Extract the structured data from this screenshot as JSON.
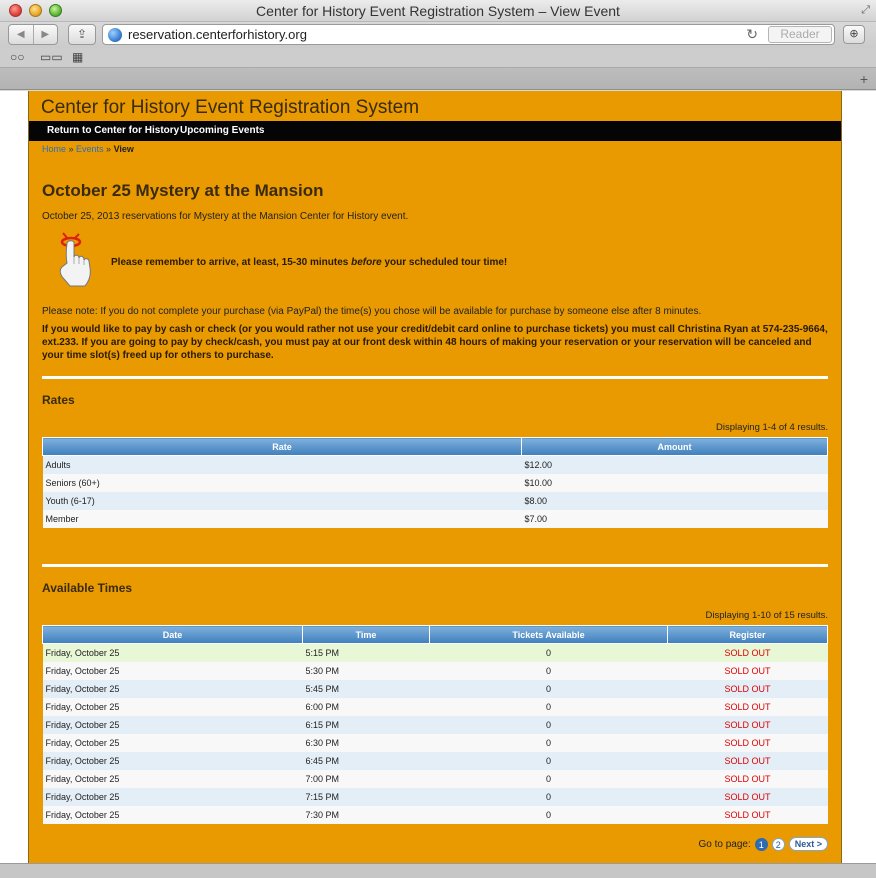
{
  "window": {
    "title": "Center for History Event Registration System – View Event",
    "url": "reservation.centerforhistory.org",
    "reader_label": "Reader",
    "nav_back": "◀",
    "nav_forward": "▶",
    "share": "⇪",
    "reload": "↻",
    "download": "⊕",
    "fullscreen": "⤢",
    "new_tab": "+",
    "bookmark_icons": [
      "○○",
      "▭▭",
      "▦"
    ]
  },
  "site": {
    "title": "Center for History Event Registration System",
    "menu": [
      "Return to Center for History",
      "Upcoming Events"
    ],
    "breadcrumb": {
      "home": "Home",
      "sep1": " » ",
      "events": "Events",
      "sep2": " » ",
      "current": "View"
    }
  },
  "event": {
    "title": "October 25 Mystery at the Mansion",
    "subtitle": "October 25, 2013 reservations for Mystery at the Mansion Center for History event.",
    "reminder_pre": "Please remember to arrive, at least, 15-30 minutes ",
    "reminder_em": "before",
    "reminder_post": " your scheduled tour time!",
    "note": "Please note: If you do not complete your purchase (via PayPal) the time(s) you chose will be available for purchase by someone else after 8 minutes.",
    "bold_note": "If you would like to pay by cash or check (or you would rather not use your credit/debit card online to purchase tickets) you must call Christina Ryan at 574-235-9664, ext.233. If you are going to pay by check/cash, you must pay at our front desk within 48 hours of making your reservation or your reservation will be canceled and your time slot(s) freed up for others to purchase."
  },
  "rates": {
    "heading": "Rates",
    "summary": "Displaying 1-4 of 4 results.",
    "columns": [
      "Rate",
      "Amount"
    ],
    "rows": [
      {
        "rate": "Adults",
        "amount": "$12.00"
      },
      {
        "rate": "Seniors (60+)",
        "amount": "$10.00"
      },
      {
        "rate": "Youth (6-17)",
        "amount": "$8.00"
      },
      {
        "rate": "Member",
        "amount": "$7.00"
      }
    ]
  },
  "times": {
    "heading": "Available Times",
    "summary": "Displaying 1-10 of 15 results.",
    "columns": [
      "Date",
      "Time",
      "Tickets Available",
      "Register"
    ],
    "rows": [
      {
        "date": "Friday, October 25",
        "time": "5:15 PM",
        "tickets": "0",
        "register": "SOLD OUT"
      },
      {
        "date": "Friday, October 25",
        "time": "5:30 PM",
        "tickets": "0",
        "register": "SOLD OUT"
      },
      {
        "date": "Friday, October 25",
        "time": "5:45 PM",
        "tickets": "0",
        "register": "SOLD OUT"
      },
      {
        "date": "Friday, October 25",
        "time": "6:00 PM",
        "tickets": "0",
        "register": "SOLD OUT"
      },
      {
        "date": "Friday, October 25",
        "time": "6:15 PM",
        "tickets": "0",
        "register": "SOLD OUT"
      },
      {
        "date": "Friday, October 25",
        "time": "6:30 PM",
        "tickets": "0",
        "register": "SOLD OUT"
      },
      {
        "date": "Friday, October 25",
        "time": "6:45 PM",
        "tickets": "0",
        "register": "SOLD OUT"
      },
      {
        "date": "Friday, October 25",
        "time": "7:00 PM",
        "tickets": "0",
        "register": "SOLD OUT"
      },
      {
        "date": "Friday, October 25",
        "time": "7:15 PM",
        "tickets": "0",
        "register": "SOLD OUT"
      },
      {
        "date": "Friday, October 25",
        "time": "7:30 PM",
        "tickets": "0",
        "register": "SOLD OUT"
      }
    ]
  },
  "pager": {
    "label": "Go to page:",
    "pages": [
      "1",
      "2"
    ],
    "next": "Next >"
  },
  "colors": {
    "page_bg": "#e89a00",
    "menu_bg": "#050505",
    "header_blue": "#3f7fbd",
    "sold_out": "#e00000",
    "link": "#2a6fc1"
  }
}
